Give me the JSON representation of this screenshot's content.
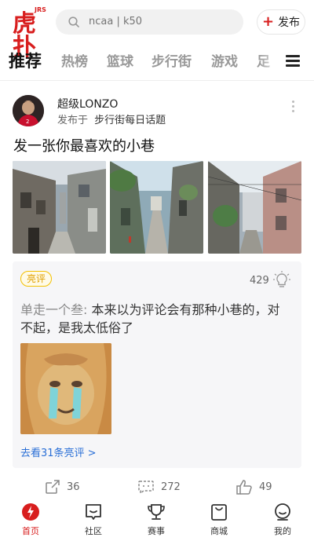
{
  "app": {
    "logo_text": "虎扑",
    "logo_small": "JRS"
  },
  "search": {
    "placeholder": "ncaa | k50",
    "icon": "search-icon"
  },
  "publish": {
    "label": "发布",
    "icon": "plus-icon"
  },
  "tabs": [
    {
      "label": "推荐",
      "active": true
    },
    {
      "label": "热榜"
    },
    {
      "label": "篮球"
    },
    {
      "label": "步行街"
    },
    {
      "label": "游戏"
    },
    {
      "label": "足"
    }
  ],
  "post": {
    "author": "超级LONZO",
    "published_prefix": "发布于",
    "topic": "步行街每日话题",
    "title": "发一张你最喜欢的小巷",
    "photos": [
      "alley-photo-1",
      "alley-photo-2",
      "alley-photo-3"
    ]
  },
  "hot_comment": {
    "badge": "亮评",
    "like_count": "429",
    "commenter": "单走一个叁:",
    "text": "本来以为评论会有那种小巷的，对不起，是我太低俗了",
    "more_link": "去看31条亮评 >"
  },
  "actions": {
    "share_count": "36",
    "comment_count": "272",
    "like_count": "49"
  },
  "bottom_nav": [
    {
      "label": "首页",
      "icon": "home-icon",
      "active": true
    },
    {
      "label": "社区",
      "icon": "community-icon"
    },
    {
      "label": "赛事",
      "icon": "trophy-icon"
    },
    {
      "label": "商城",
      "icon": "shop-icon"
    },
    {
      "label": "我的",
      "icon": "profile-icon"
    }
  ],
  "colors": {
    "brand": "#d81e1e",
    "link": "#2a6fd6",
    "badge": "#e0a000"
  }
}
